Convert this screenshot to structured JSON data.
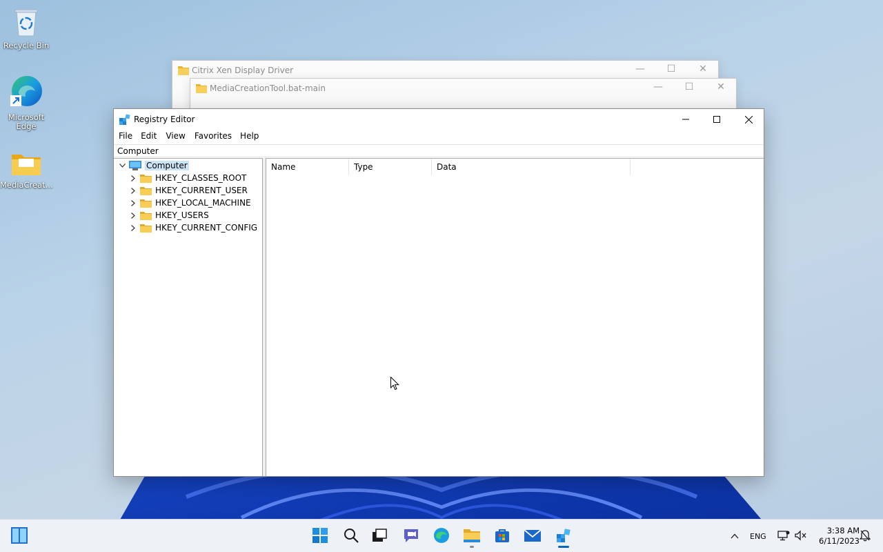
{
  "desktop": {
    "icons": [
      {
        "label": "Recycle Bin",
        "icon": "recycle-bin-icon"
      },
      {
        "label": "Microsoft Edge",
        "icon": "edge-icon"
      },
      {
        "label": "MediaCreat...",
        "icon": "folder-icon"
      }
    ]
  },
  "background_windows": [
    {
      "title": "Citrix Xen Display Driver"
    },
    {
      "title": "MediaCreationTool.bat-main"
    }
  ],
  "regedit": {
    "title": "Registry Editor",
    "controls": {
      "minimize": "—",
      "maximize": "☐",
      "close": "✕"
    },
    "menus": [
      "File",
      "Edit",
      "View",
      "Favorites",
      "Help"
    ],
    "address": "Computer",
    "tree": {
      "root": "Computer",
      "children": [
        "HKEY_CLASSES_ROOT",
        "HKEY_CURRENT_USER",
        "HKEY_LOCAL_MACHINE",
        "HKEY_USERS",
        "HKEY_CURRENT_CONFIG"
      ]
    },
    "columns": [
      "Name",
      "Type",
      "Data"
    ]
  },
  "taskbar": {
    "apps": [
      "start-icon",
      "search-icon",
      "task-view-icon",
      "chat-icon",
      "edge-icon",
      "file-explorer-icon",
      "store-icon",
      "mail-icon",
      "registry-editor-icon"
    ],
    "language": "ENG",
    "time": "3:38 AM",
    "date": "6/11/2023"
  },
  "colors": {
    "accent": "#0067c0",
    "selection": "#cce4f7",
    "folder": "#f5c84c"
  }
}
